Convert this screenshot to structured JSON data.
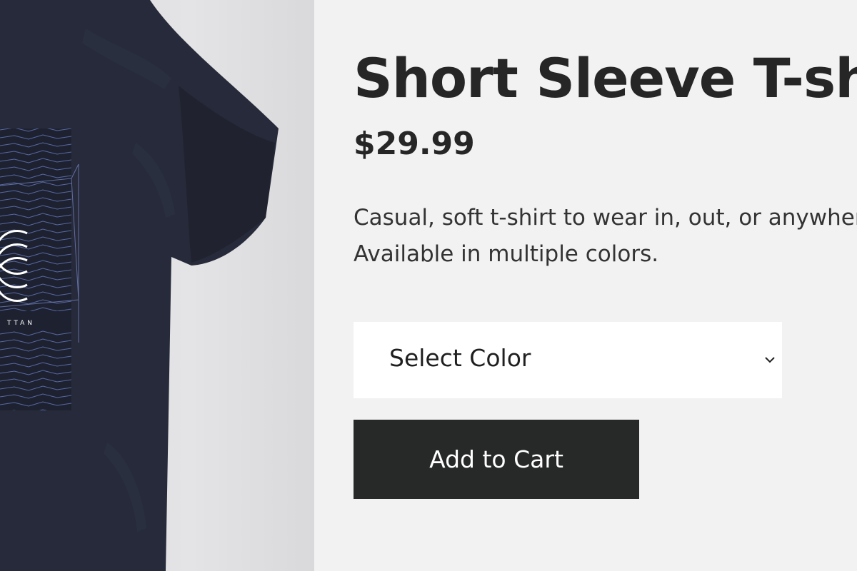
{
  "product": {
    "title": "Short Sleeve T-shirt",
    "price": "$29.99",
    "description_lines": [
      "Casual, soft t-shirt to wear in, out, or anywhere.",
      "Available in multiple colors."
    ],
    "image_alt": "Navy short sleeve t-shirt with geometric graphic print"
  },
  "color_select": {
    "selected_label": "Select Color"
  },
  "actions": {
    "add_to_cart_label": "Add to Cart"
  },
  "colors": {
    "page_background": "#f2f2f2",
    "shirt": "#262a3a",
    "print_lines": "#5d6fb0",
    "button_background": "#272828",
    "button_text": "#ffffff",
    "text": "#262626"
  }
}
